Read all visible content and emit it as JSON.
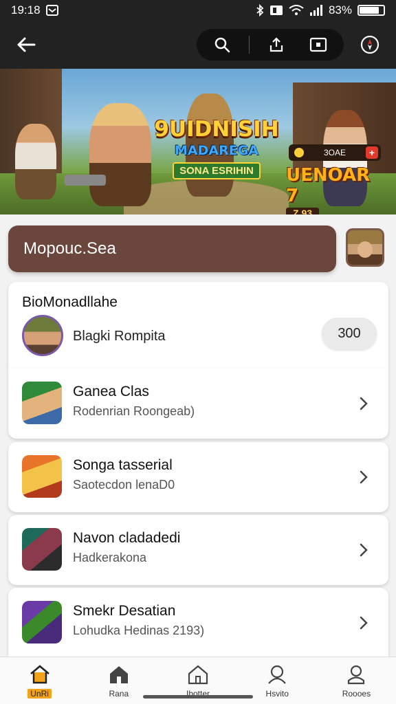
{
  "status_bar": {
    "time": "19:18",
    "battery_percent": "83%",
    "battery_level": 0.83,
    "icons": [
      "notification-icon",
      "bluetooth-icon",
      "nfc-icon",
      "wifi-icon",
      "signal-icon",
      "battery-icon"
    ]
  },
  "app_bar": {
    "back_icon": "back-arrow-icon",
    "actions": [
      "search-icon",
      "share-icon",
      "cast-icon",
      "compass-icon"
    ]
  },
  "banner": {
    "logo_line1": "9UIDNISIH",
    "logo_line2": "MADAREGA",
    "logo_line3": "SONA ESRIHIN",
    "promo_title": "UENOAR 7",
    "promo_sub": "Z 93",
    "coin_label": "3OAE",
    "plus_label": "+"
  },
  "search": {
    "value": "Mopouc.Sea"
  },
  "featured": {
    "title": "BioMonadllahe",
    "name": "Blagki Rompita",
    "count": "300"
  },
  "list": [
    {
      "title": "Ganea Clas",
      "subtitle": "Rodenrian Roongeab)"
    },
    {
      "title": "Songa tasserial",
      "subtitle": "Saotecdon lenaD0"
    },
    {
      "title": "Navon cladadedi",
      "subtitle": "Hadkerakona"
    },
    {
      "title": "Smekr Desatian",
      "subtitle": "Lohudka Hedinas 2193)"
    }
  ],
  "bottom_nav": [
    {
      "label": "UnRi",
      "icon": "home-icon",
      "active": true
    },
    {
      "label": "Rana",
      "icon": "store-icon",
      "active": false
    },
    {
      "label": "Ibotter",
      "icon": "house-outline-icon",
      "active": false
    },
    {
      "label": "Hsvito",
      "icon": "profile-icon",
      "active": false
    },
    {
      "label": "Roooes",
      "icon": "account-icon",
      "active": false
    }
  ],
  "colors": {
    "dark_bar": "#222222",
    "search_bg": "#6b463d",
    "active_nav": "#f3a31a",
    "card_bg": "#ffffff",
    "page_bg": "#f2f2f2"
  }
}
